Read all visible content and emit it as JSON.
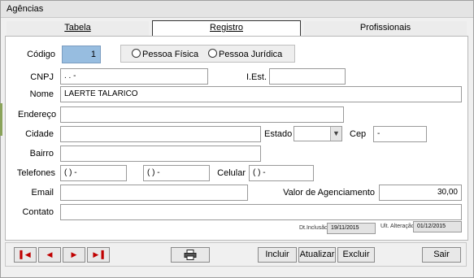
{
  "window": {
    "title": "Agências"
  },
  "tabs": [
    {
      "label": "Tabela",
      "active": false
    },
    {
      "label": "Registro",
      "active": true
    },
    {
      "label": "Profissionais",
      "active": false
    }
  ],
  "form": {
    "codigo": {
      "label": "Código",
      "value": "1"
    },
    "tipo_pessoa": {
      "fisica": "Pessoa Física",
      "juridica": "Pessoa Jurídica"
    },
    "cnpj": {
      "label": "CNPJ",
      "value": "  .  .  -"
    },
    "iest": {
      "label": "I.Est.",
      "value": ""
    },
    "nome": {
      "label": "Nome",
      "value": "LAERTE TALARICO"
    },
    "endereco": {
      "label": "Endereço",
      "value": ""
    },
    "cidade": {
      "label": "Cidade",
      "value": ""
    },
    "estado": {
      "label": "Estado",
      "value": ""
    },
    "cep": {
      "label": "Cep",
      "value": "   -"
    },
    "bairro": {
      "label": "Bairro",
      "value": ""
    },
    "telefones": {
      "label": "Telefones",
      "value1": "( )   -",
      "value2": "( )   -"
    },
    "celular": {
      "label": "Celular",
      "value": "( )   -"
    },
    "email": {
      "label": "Email",
      "value": ""
    },
    "valor_agenciamento": {
      "label": "Valor de Agenciamento",
      "value": "30,00"
    },
    "contato": {
      "label": "Contato",
      "value": ""
    },
    "dt_inclusao": {
      "label": "Dt.Inclusão",
      "value": "19/11/2015"
    },
    "ult_alteracao": {
      "label": "Ult. Alteração",
      "value": "01/12/2015"
    }
  },
  "nav_icons": [
    "first-record-icon",
    "prev-record-icon",
    "next-record-icon",
    "last-record-icon"
  ],
  "buttons": {
    "incluir": "Incluir",
    "atualizar": "Atualizar",
    "excluir": "Excluir",
    "sair": "Sair"
  },
  "colors": {
    "codigo_bg": "#97bde0",
    "nav_arrows": "#c00000"
  }
}
